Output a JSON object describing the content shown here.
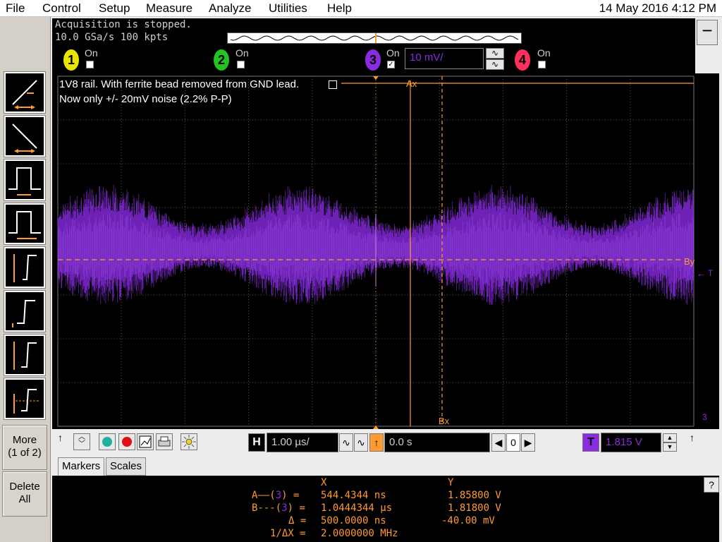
{
  "menu": {
    "items": [
      "File",
      "Control",
      "Setup",
      "Measure",
      "Analyze",
      "Utilities",
      "Help"
    ],
    "datetime": "14 May 2016  4:12 PM"
  },
  "acquisition": {
    "status": "Acquisition is stopped.",
    "rate": "10.0 GSa/s   100 kpts"
  },
  "channels": [
    {
      "num": "1",
      "on_label": "On",
      "checked": false,
      "color": "#e6e600"
    },
    {
      "num": "2",
      "on_label": "On",
      "checked": false,
      "color": "#22c322"
    },
    {
      "num": "3",
      "on_label": "On",
      "checked": true,
      "color": "#8a2be2",
      "scale": "10 mV/"
    },
    {
      "num": "4",
      "on_label": "On",
      "checked": false,
      "color": "#ff3060"
    }
  ],
  "annotation": {
    "line1": "1V8 rail. With ferrite bead removed from GND lead.",
    "line2": "Now only +/- 20mV noise (2.2% P-P)"
  },
  "cursor_labels": {
    "ax": "Ax",
    "bx": "Bx",
    "by": "By",
    "trig": "T",
    "ch3_marker": "3"
  },
  "side_buttons": {
    "more": "More\n(1 of 2)",
    "more_line1": "More",
    "more_line2": "(1 of 2)",
    "delete_line1": "Delete",
    "delete_line2": "All"
  },
  "horizontal": {
    "letter": "H",
    "scale": "1.00 µs/",
    "position": "0.0 s",
    "ref": "0"
  },
  "trigger": {
    "letter": "T",
    "level": "1.815 V"
  },
  "tabs": {
    "markers": "Markers",
    "scales": "Scales"
  },
  "markers": {
    "header_x": "X",
    "header_y": "Y",
    "rows": [
      {
        "label": "A——(",
        "ch": "3",
        "close": ") =",
        "x": "544.4344 ns",
        "y": "1.85800 V"
      },
      {
        "label": "B---(",
        "ch": "3",
        "close": ") =",
        "x": "1.0444344 µs",
        "y": "1.81800 V"
      },
      {
        "label": "Δ",
        "ch": "",
        "close": " =",
        "x": "500.0000 ns",
        "y": "-40.00 mV"
      },
      {
        "label": "1/ΔX",
        "ch": "",
        "close": " =",
        "x": "2.0000000 MHz",
        "y": ""
      }
    ]
  },
  "colors": {
    "trace": "#8a2be2",
    "cursor": "#ff9a30",
    "grid": "#5a5a5a"
  }
}
